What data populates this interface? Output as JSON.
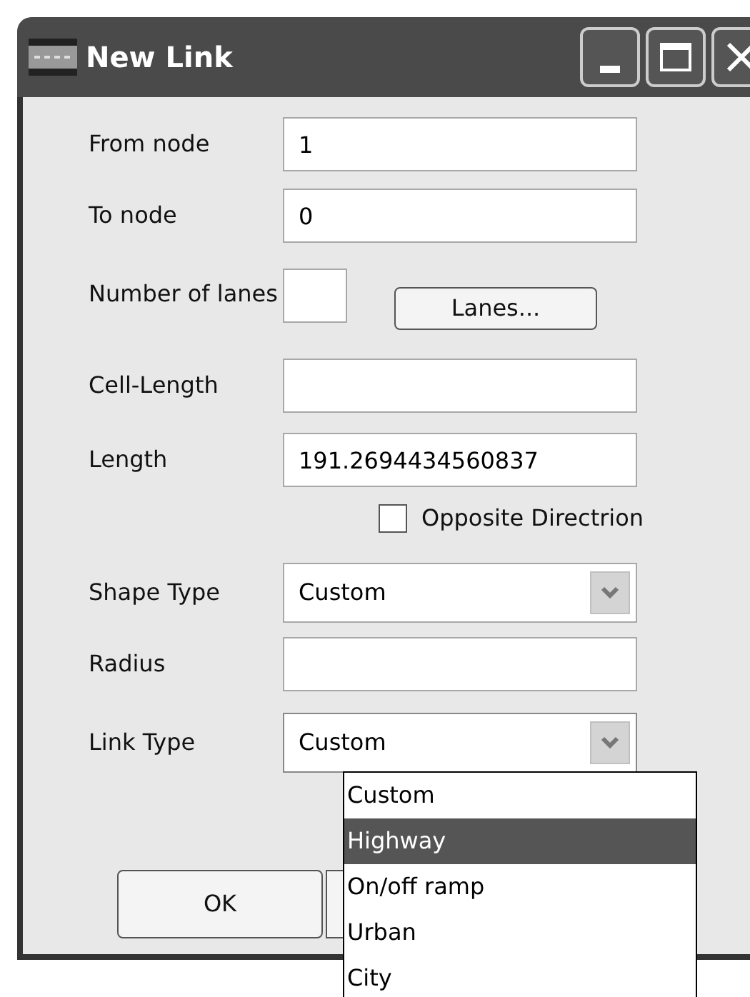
{
  "window": {
    "title": "New Link"
  },
  "fields": [
    {
      "kind": "text",
      "label": "From node",
      "value": "1"
    },
    {
      "kind": "text",
      "label": "To node",
      "value": "0"
    },
    {
      "kind": "lanes",
      "label": "Number of lanes",
      "button": "Lanes..."
    },
    {
      "kind": "text",
      "label": "Cell-Length"
    },
    {
      "kind": "text",
      "label": "Length",
      "value": "191.2694434560837"
    },
    {
      "kind": "checkbox",
      "label": "Opposite Directrion",
      "checked": false
    },
    {
      "kind": "combo",
      "label": "Shape Type",
      "value": "Custom"
    },
    {
      "kind": "text",
      "label": "Radius"
    },
    {
      "kind": "combo",
      "label": "Link Type",
      "value": "Custom",
      "expanded": true
    }
  ],
  "dropdown_options": [
    {
      "label": "Custom",
      "selected": false
    },
    {
      "label": "Highway",
      "selected": true
    },
    {
      "label": "On/off ramp",
      "selected": false
    },
    {
      "label": "Urban",
      "selected": false
    },
    {
      "label": "City",
      "selected": false
    }
  ],
  "buttons": [
    "OK"
  ]
}
